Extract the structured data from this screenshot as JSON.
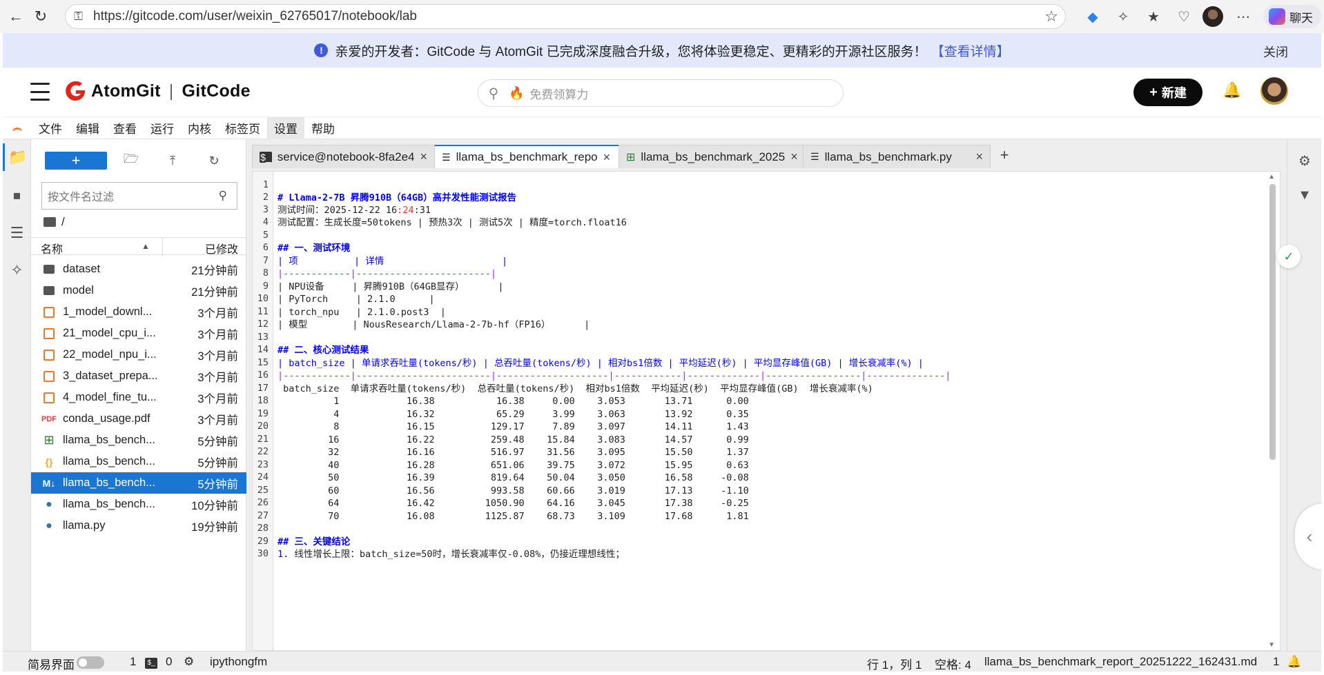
{
  "browser": {
    "url": "https://gitcode.com/user/weixin_62765017/notebook/lab",
    "chat_label": "聊天"
  },
  "banner": {
    "message": "亲爱的开发者：GitCode 与 AtomGit 已完成深度融合升级，您将体验更稳定、更精彩的开源社区服务！",
    "link": "【查看详情】",
    "close": "关闭"
  },
  "site": {
    "brand_left": "AtomGit",
    "brand_sep": "|",
    "brand_right": "GitCode",
    "search_placeholder": "免费领算力",
    "new_button": "新建"
  },
  "menubar": {
    "items": [
      "文件",
      "编辑",
      "查看",
      "运行",
      "内核",
      "标签页",
      "设置",
      "帮助"
    ],
    "active": "设置"
  },
  "filebrowser": {
    "filter_placeholder": "按文件名过滤",
    "path": "/",
    "col_name": "名称",
    "col_modified": "已修改",
    "files": [
      {
        "name": "dataset",
        "modified": "21分钟前",
        "icon": "folder-icon"
      },
      {
        "name": "model",
        "modified": "21分钟前",
        "icon": "folder-icon"
      },
      {
        "name": "1_model_downl...",
        "modified": "3个月前",
        "icon": "notebook-icon"
      },
      {
        "name": "21_model_cpu_i...",
        "modified": "3个月前",
        "icon": "notebook-icon"
      },
      {
        "name": "22_model_npu_i...",
        "modified": "3个月前",
        "icon": "notebook-icon"
      },
      {
        "name": "3_dataset_prepa...",
        "modified": "3个月前",
        "icon": "notebook-icon"
      },
      {
        "name": "4_model_fine_tu...",
        "modified": "3个月前",
        "icon": "notebook-icon"
      },
      {
        "name": "conda_usage.pdf",
        "modified": "3个月前",
        "icon": "pdf-icon"
      },
      {
        "name": "llama_bs_bench...",
        "modified": "5分钟前",
        "icon": "csv-icon"
      },
      {
        "name": "llama_bs_bench...",
        "modified": "5分钟前",
        "icon": "json-icon"
      },
      {
        "name": "llama_bs_bench...",
        "modified": "5分钟前",
        "icon": "markdown-icon",
        "selected": true
      },
      {
        "name": "llama_bs_bench...",
        "modified": "10分钟前",
        "icon": "python-icon"
      },
      {
        "name": "llama.py",
        "modified": "19分钟前",
        "icon": "python-icon"
      }
    ]
  },
  "tabs": [
    {
      "label": "service@notebook-8fa2e4",
      "icon": "terminal-icon"
    },
    {
      "label": "llama_bs_benchmark_repo",
      "icon": "text-file-icon",
      "active": true
    },
    {
      "label": "llama_bs_benchmark_2025",
      "icon": "csv-icon"
    },
    {
      "label": "llama_bs_benchmark.py",
      "icon": "text-file-icon"
    }
  ],
  "editor": {
    "title": "# Llama-2-7B 昇腾910B（64GB）高并发性能测试报告",
    "test_time_label": "测试时间：2025-12-22 16",
    "test_time_colon": ":",
    "test_time_mid": "24",
    "test_time_end": ":31",
    "config": "测试配置：生成长度=50tokens | 预热3次 | 测试5次 | 精度=torch.float16",
    "env_heading": "## 一、测试环境",
    "env_header": "| 项          | 详情                     |",
    "env_sep": "|------------|------------------------|",
    "env_rows": [
      "| NPU设备     | 昇腾910B（64GB显存）      |",
      "| PyTorch     | 2.1.0      |",
      "| torch_npu   | 2.1.0.post3  |",
      "| 模型        | NousResearch/Llama-2-7b-hf（FP16）      |"
    ],
    "results_heading": "## 二、核心测试结果",
    "results_header": "| batch_size | 单请求吞吐量(tokens/秒) | 总吞吐量(tokens/秒) | 相对bs1倍数 | 平均延迟(秒) | 平均显存峰值(GB) | 增长衰减率(%) |",
    "results_sep": "|------------|------------------------|--------------------|------------|-------------|-----------------|--------------|",
    "table_header": " batch_size  单请求吞吐量(tokens/秒)  总吞吐量(tokens/秒)  相对bs1倍数  平均延迟(秒)  平均显存峰值(GB)  增长衰减率(%)",
    "table_rows": [
      "          1            16.38           16.38     0.00    3.053       13.71      0.00",
      "          4            16.32           65.29     3.99    3.063       13.92      0.35",
      "          8            16.15          129.17     7.89    3.097       14.11      1.43",
      "         16            16.22          259.48    15.84    3.083       14.57      0.99",
      "         32            16.16          516.97    31.56    3.095       15.50      1.37",
      "         40            16.28          651.06    39.75    3.072       15.95      0.63",
      "         50            16.39          819.64    50.04    3.050       16.58     -0.08",
      "         60            16.56          993.58    60.66    3.019       17.13     -1.10",
      "         64            16.42         1050.90    64.16    3.045       17.38     -0.25",
      "         70            16.08         1125.87    68.73    3.109       17.68      1.81"
    ],
    "conclusion_heading": "## 三、关键结论",
    "conclusion_num": "1.",
    "conclusion_line": " 线性增长上限：batch_size=50时，增长衰减率仅-0.08%，仍接近理想线性；"
  },
  "statusbar": {
    "simple_mode": "简易界面",
    "kernels": "1",
    "terminals": "0",
    "kernel_name": "ipythongfm",
    "cursor": "行 1，列 1",
    "spaces": "空格: 4",
    "filename": "llama_bs_benchmark_report_20251222_162431.md",
    "notifications": "1"
  }
}
